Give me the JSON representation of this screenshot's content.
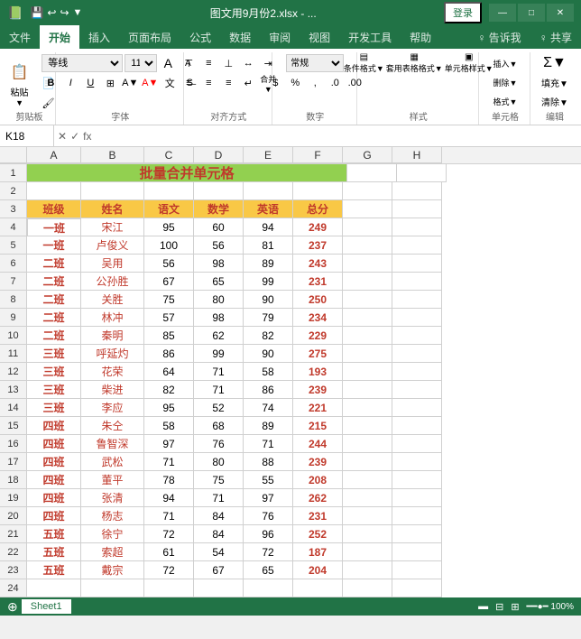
{
  "titlebar": {
    "filename": "图文用9月份2.xlsx - ...",
    "login": "登录",
    "winControls": [
      "—",
      "□",
      "✕"
    ]
  },
  "quickAccess": {
    "icons": [
      "💾",
      "↩",
      "↪",
      "📄",
      "📋"
    ]
  },
  "ribbonTabs": [
    {
      "label": "文件",
      "active": false
    },
    {
      "label": "开始",
      "active": true
    },
    {
      "label": "插入",
      "active": false
    },
    {
      "label": "页面布局",
      "active": false
    },
    {
      "label": "公式",
      "active": false
    },
    {
      "label": "数据",
      "active": false
    },
    {
      "label": "审阅",
      "active": false
    },
    {
      "label": "视图",
      "active": false
    },
    {
      "label": "开发工具",
      "active": false
    },
    {
      "label": "帮助",
      "active": false
    },
    {
      "label": "♀",
      "active": false
    },
    {
      "label": "告诉我",
      "active": false
    },
    {
      "label": "♀ 共享",
      "active": false
    }
  ],
  "formulaBar": {
    "cellRef": "K18",
    "formula": ""
  },
  "columns": [
    "A",
    "B",
    "C",
    "D",
    "E",
    "F",
    "G",
    "H"
  ],
  "spreadsheet": {
    "title": "批量合并单元格",
    "headers": [
      "班级",
      "姓名",
      "语文",
      "数学",
      "英语",
      "总分"
    ],
    "rows": [
      {
        "row": 4,
        "class": "一班",
        "name": "宋江",
        "chinese": 95,
        "math": 60,
        "english": 94,
        "total": 249
      },
      {
        "row": 5,
        "class": "一班",
        "name": "卢俊义",
        "chinese": 100,
        "math": 56,
        "english": 81,
        "total": 237
      },
      {
        "row": 6,
        "class": "二班",
        "name": "吴用",
        "chinese": 56,
        "math": 98,
        "english": 89,
        "total": 243
      },
      {
        "row": 7,
        "class": "二班",
        "name": "公孙胜",
        "chinese": 67,
        "math": 65,
        "english": 99,
        "total": 231
      },
      {
        "row": 8,
        "class": "二班",
        "name": "关胜",
        "chinese": 75,
        "math": 80,
        "english": 90,
        "total": 250
      },
      {
        "row": 9,
        "class": "二班",
        "name": "林冲",
        "chinese": 57,
        "math": 98,
        "english": 79,
        "total": 234
      },
      {
        "row": 10,
        "class": "二班",
        "name": "秦明",
        "chinese": 85,
        "math": 62,
        "english": 82,
        "total": 229
      },
      {
        "row": 11,
        "class": "三班",
        "name": "呼延灼",
        "chinese": 86,
        "math": 99,
        "english": 90,
        "total": 275
      },
      {
        "row": 12,
        "class": "三班",
        "name": "花荣",
        "chinese": 64,
        "math": 71,
        "english": 58,
        "total": 193
      },
      {
        "row": 13,
        "class": "三班",
        "name": "柴进",
        "chinese": 82,
        "math": 71,
        "english": 86,
        "total": 239
      },
      {
        "row": 14,
        "class": "三班",
        "name": "李应",
        "chinese": 95,
        "math": 52,
        "english": 74,
        "total": 221
      },
      {
        "row": 15,
        "class": "四班",
        "name": "朱仝",
        "chinese": 58,
        "math": 68,
        "english": 89,
        "total": 215
      },
      {
        "row": 16,
        "class": "四班",
        "name": "鲁智深",
        "chinese": 97,
        "math": 76,
        "english": 71,
        "total": 244
      },
      {
        "row": 17,
        "class": "四班",
        "name": "武松",
        "chinese": 71,
        "math": 80,
        "english": 88,
        "total": 239
      },
      {
        "row": 18,
        "class": "四班",
        "name": "董平",
        "chinese": 78,
        "math": 75,
        "english": 55,
        "total": 208
      },
      {
        "row": 19,
        "class": "四班",
        "name": "张清",
        "chinese": 94,
        "math": 71,
        "english": 97,
        "total": 262
      },
      {
        "row": 20,
        "class": "四班",
        "name": "杨志",
        "chinese": 71,
        "math": 84,
        "english": 76,
        "total": 231
      },
      {
        "row": 21,
        "class": "五班",
        "name": "徐宁",
        "chinese": 72,
        "math": 84,
        "english": 96,
        "total": 252
      },
      {
        "row": 22,
        "class": "五班",
        "name": "索超",
        "chinese": 61,
        "math": 54,
        "english": 72,
        "total": 187
      },
      {
        "row": 23,
        "class": "五班",
        "name": "戴宗",
        "chinese": 72,
        "math": 67,
        "english": 65,
        "total": 204
      }
    ]
  },
  "statusBar": {
    "info": "",
    "sheets": [
      "Sheet1"
    ]
  }
}
